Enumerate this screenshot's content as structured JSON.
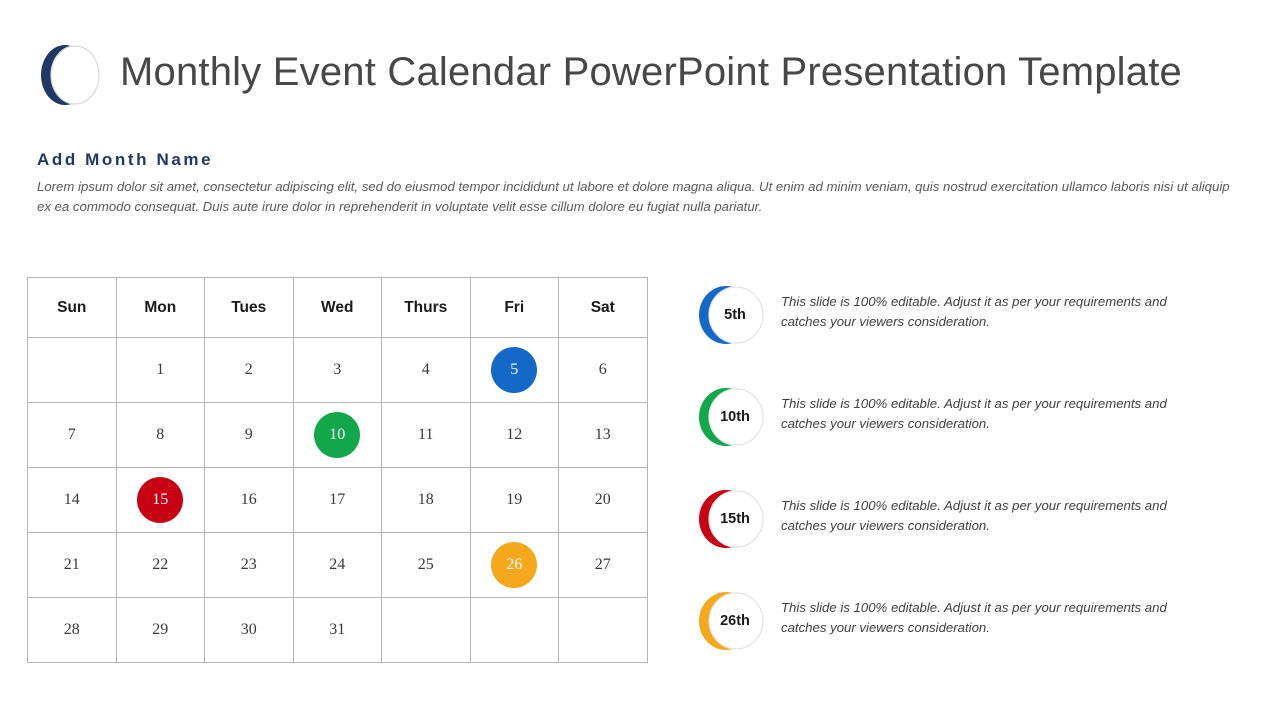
{
  "header": {
    "title": "Monthly Event Calendar PowerPoint Presentation Template",
    "logo_icon": "crescent-moon-icon",
    "logo_color": "#1f3864"
  },
  "section": {
    "heading": "Add Month Name",
    "heading_color": "#1f3864",
    "paragraph": "Lorem ipsum dolor sit amet, consectetur adipiscing elit, sed do eiusmod tempor incididunt ut labore et dolore magna aliqua. Ut enim ad minim veniam, quis nostrud exercitation ullamco laboris nisi ut aliquip ex ea commodo consequat. Duis aute irure dolor in reprehenderit in voluptate velit esse cillum dolore eu fugiat nulla pariatur."
  },
  "calendar": {
    "headers": [
      "Sun",
      "Mon",
      "Tues",
      "Wed",
      "Thurs",
      "Fri",
      "Sat"
    ],
    "grid_color": "#b4b4b4",
    "rows": [
      [
        {
          "day": ""
        },
        {
          "day": "1"
        },
        {
          "day": "2"
        },
        {
          "day": "3"
        },
        {
          "day": "4"
        },
        {
          "day": "5",
          "marked": true,
          "color": "#1468c8"
        },
        {
          "day": "6"
        }
      ],
      [
        {
          "day": "7"
        },
        {
          "day": "8"
        },
        {
          "day": "9"
        },
        {
          "day": "10",
          "marked": true,
          "color": "#11a74a"
        },
        {
          "day": "11"
        },
        {
          "day": "12"
        },
        {
          "day": "13"
        }
      ],
      [
        {
          "day": "14"
        },
        {
          "day": "15",
          "marked": true,
          "color": "#c80014"
        },
        {
          "day": "16"
        },
        {
          "day": "17"
        },
        {
          "day": "18"
        },
        {
          "day": "19"
        },
        {
          "day": "20"
        }
      ],
      [
        {
          "day": "21"
        },
        {
          "day": "22"
        },
        {
          "day": "23"
        },
        {
          "day": "24"
        },
        {
          "day": "25"
        },
        {
          "day": "26",
          "marked": true,
          "color": "#f5a81c"
        },
        {
          "day": "27"
        }
      ],
      [
        {
          "day": "28"
        },
        {
          "day": "29"
        },
        {
          "day": "30"
        },
        {
          "day": "31"
        },
        {
          "day": ""
        },
        {
          "day": ""
        },
        {
          "day": ""
        }
      ]
    ]
  },
  "legend": {
    "items": [
      {
        "label": "5th",
        "color": "#1468c8",
        "icon": "crescent-moon-icon",
        "text": "This slide is 100% editable. Adjust it as per your requirements and catches your viewers consideration."
      },
      {
        "label": "10th",
        "color": "#11a74a",
        "icon": "crescent-moon-icon",
        "text": "This slide is 100% editable. Adjust it as per your requirements and catches your viewers consideration."
      },
      {
        "label": "15th",
        "color": "#c80014",
        "icon": "crescent-moon-icon",
        "text": "This slide is 100% editable. Adjust it as per your requirements and catches your viewers consideration."
      },
      {
        "label": "26th",
        "color": "#f5a81c",
        "icon": "crescent-moon-icon",
        "text": "This slide is 100% editable. Adjust it as per your requirements and catches your viewers consideration."
      }
    ]
  }
}
